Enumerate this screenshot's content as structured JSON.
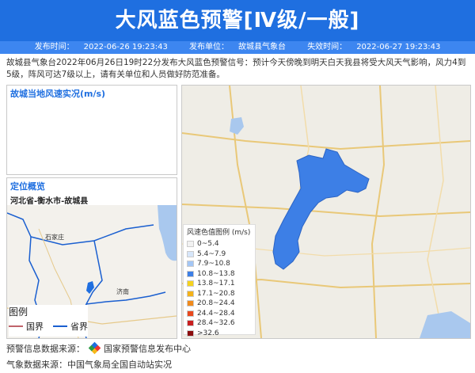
{
  "header": {
    "title": "大风蓝色预警[Ⅳ级/一般]",
    "publish_time_label": "发布时间：",
    "publish_time": "2022-06-26 19:23:43",
    "publisher_label": "发布单位：",
    "publisher": "故城县气象台",
    "expire_label": "失效时间：",
    "expire_time": "2022-06-27 19:23:43"
  },
  "description": "故城县气象台2022年06月26日19时22分发布大风蓝色预警信号：预计今天傍晚到明天白天我县将受大风天气影响，风力4到5级，阵风可达7级以上，请有关单位和人员做好防范准备。",
  "wind_panel": {
    "title": "故城当地风速实况(m/s)"
  },
  "location_panel": {
    "title": "定位概览",
    "region": "河北省-衡水市-故城县"
  },
  "overview_map": {
    "labels": {
      "shijiazhuang": "石家庄",
      "jinan": "济南"
    },
    "legend": {
      "title": "图例",
      "national_border": "国界",
      "provincial_border": "省界"
    },
    "colors": {
      "national": "#c0636b",
      "provincial": "#1a5fd0",
      "water": "#a9c8ee"
    }
  },
  "main_map": {
    "region_color": "#3d7fe6",
    "legend": {
      "title": "风速色值图例 (m/s)",
      "items": [
        {
          "label": "0~5.4",
          "color": "#f2f2f2"
        },
        {
          "label": "5.4~7.9",
          "color": "#d6e6fa"
        },
        {
          "label": "7.9~10.8",
          "color": "#a3c6f5"
        },
        {
          "label": "10.8~13.8",
          "color": "#3d7fe6"
        },
        {
          "label": "13.8~17.1",
          "color": "#f5d21e"
        },
        {
          "label": "17.1~20.8",
          "color": "#f4b21a"
        },
        {
          "label": "20.8~24.4",
          "color": "#f08a1c"
        },
        {
          "label": "24.4~28.4",
          "color": "#e8491e"
        },
        {
          "label": "28.4~32.6",
          "color": "#c81f1f"
        },
        {
          "label": ">32.6",
          "color": "#8c0d0d"
        }
      ]
    }
  },
  "footer": {
    "warning_source_label": "预警信息数据来源：",
    "warning_source": "国家预警信息发布中心",
    "weather_source_label": "气象数据来源：",
    "weather_source": "中国气象局全国自动站实况"
  }
}
